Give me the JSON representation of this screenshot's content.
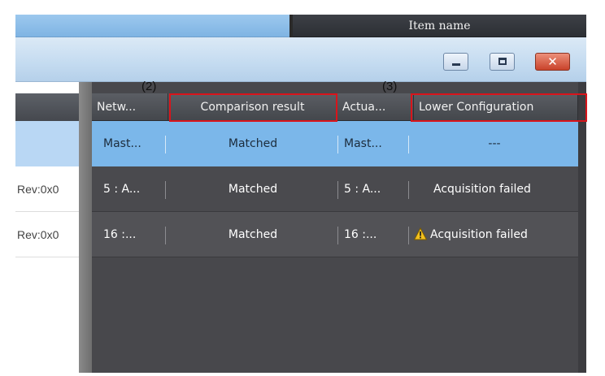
{
  "top_header": {
    "item_name": "Item name"
  },
  "window_controls": {
    "close_glyph": "✕"
  },
  "annotations": {
    "label_2": "(2)",
    "label_3": "(3)"
  },
  "left_panel": {
    "rows": [
      "Rev:0x0",
      "Rev:0x0"
    ]
  },
  "grid": {
    "columns": [
      "Netw...",
      "Comparison result",
      "Actua...",
      "Lower Configuration"
    ],
    "rows": [
      {
        "network": "Mast...",
        "comparison": "Matched",
        "actual": "Mast...",
        "lower": "---",
        "warning": false
      },
      {
        "network": "5 : A...",
        "comparison": "Matched",
        "actual": "5 : A...",
        "lower": "Acquisition failed",
        "warning": false
      },
      {
        "network": "16 :...",
        "comparison": "Matched",
        "actual": "16 :...",
        "lower": "Acquisition failed",
        "warning": true,
        "warning_icon": "warning-triangle-icon"
      }
    ]
  },
  "colors": {
    "selection": "#7bb7ea",
    "annotation": "#d9141b",
    "warning": "#f2c01e"
  }
}
